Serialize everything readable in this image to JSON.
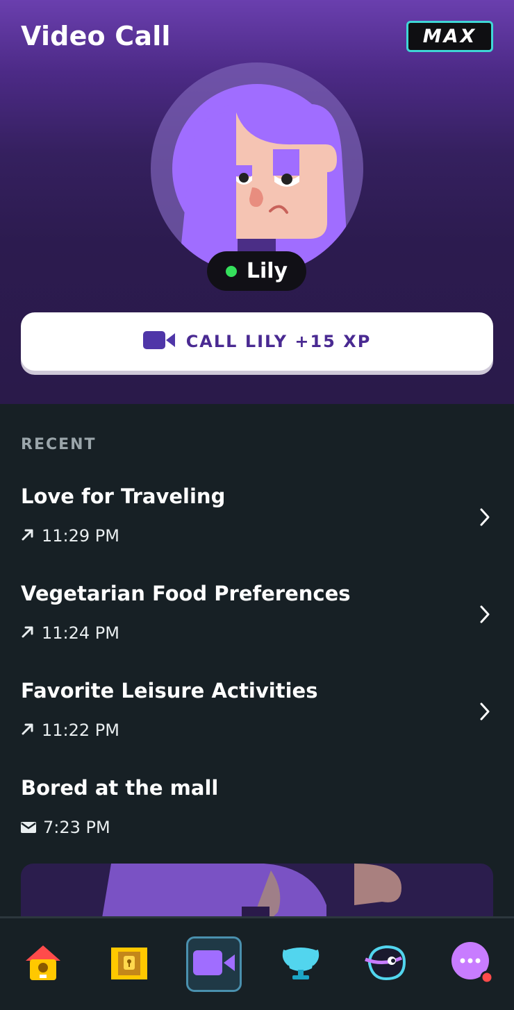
{
  "header": {
    "title": "Video Call",
    "badge": "MAX"
  },
  "contact": {
    "name": "Lily",
    "status_color": "#35e05c"
  },
  "call_button": {
    "label": "CALL LILY +15 XP",
    "icon": "video-camera-icon"
  },
  "recent": {
    "heading": "RECENT",
    "items": [
      {
        "title": "Love for Traveling",
        "time": "11:29 PM",
        "icon": "outgoing-arrow-icon",
        "has_chevron": true
      },
      {
        "title": "Vegetarian Food Preferences",
        "time": "11:24 PM",
        "icon": "outgoing-arrow-icon",
        "has_chevron": true
      },
      {
        "title": "Favorite Leisure Activities",
        "time": "11:22 PM",
        "icon": "outgoing-arrow-icon",
        "has_chevron": true
      },
      {
        "title": "Bored at the mall",
        "time": "7:23 PM",
        "icon": "envelope-icon",
        "has_chevron": false
      }
    ]
  },
  "tabs": [
    {
      "name": "home",
      "icon": "birdhouse-icon",
      "active": false
    },
    {
      "name": "treasure",
      "icon": "treasure-chest-icon",
      "active": false
    },
    {
      "name": "video-call",
      "icon": "video-camera-icon",
      "active": true
    },
    {
      "name": "leagues",
      "icon": "trophy-icon",
      "active": false
    },
    {
      "name": "characters",
      "icon": "character-icon",
      "active": false
    },
    {
      "name": "more",
      "icon": "more-dots-icon",
      "active": false
    }
  ],
  "colors": {
    "accent": "#4a2a92",
    "max_border": "#3fd7d6",
    "video_icon": "#4f36a8",
    "background": "#172025"
  }
}
